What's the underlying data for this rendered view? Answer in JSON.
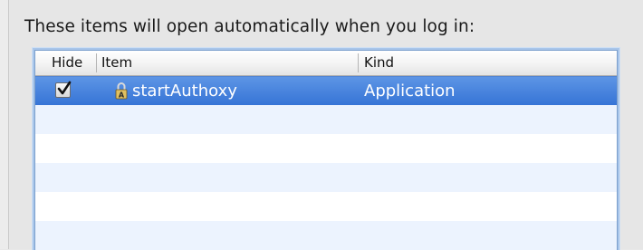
{
  "login_items": {
    "heading": "These items will open automatically when you log in:",
    "columns": {
      "hide": "Hide",
      "item": "Item",
      "kind": "Kind"
    },
    "rows": [
      {
        "hide": true,
        "icon": "lock-icon",
        "item": "startAuthoxy",
        "kind": "Application",
        "selected": true
      }
    ]
  },
  "colors": {
    "selection": "#3674d6",
    "stripe": "#ecf3fe",
    "focus_ring": "#a9c6ea"
  }
}
